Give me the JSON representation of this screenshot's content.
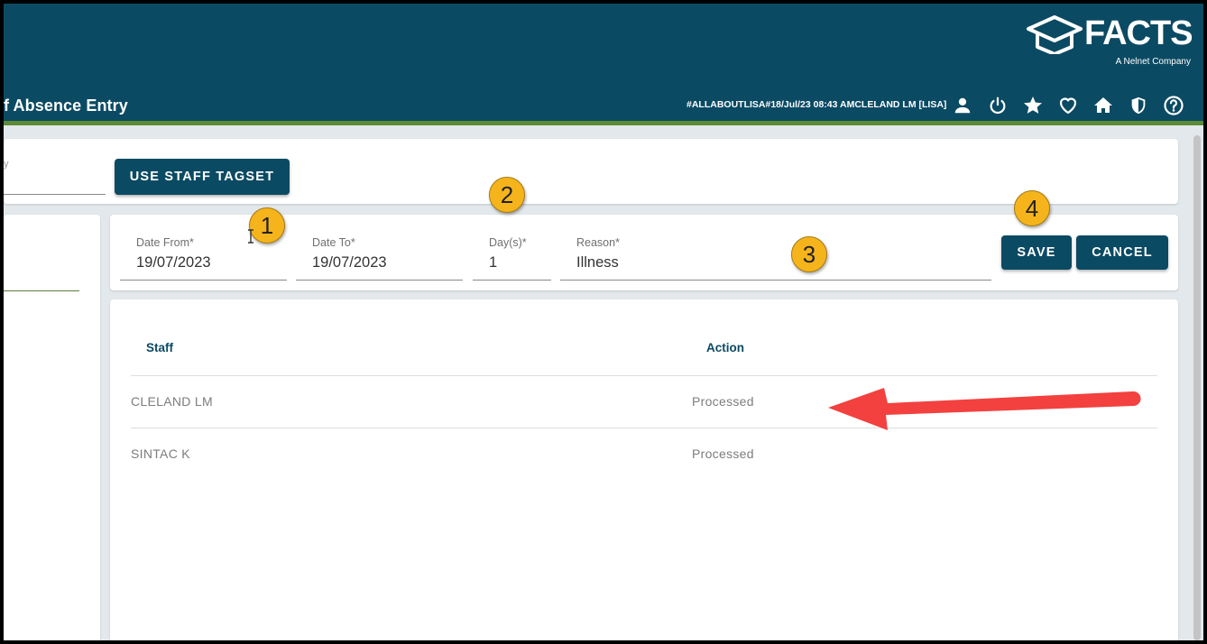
{
  "header": {
    "page_title": "f Absence Entry",
    "brand": "FACTS",
    "brand_tagline": "A Nelnet Company",
    "session_info": "#ALLABOUTLISA#18/Jul/23 08:43 AMCLELAND LM [LISA]",
    "icons": [
      "user-icon",
      "power-icon",
      "star-icon",
      "heart-icon",
      "home-icon",
      "shield-icon",
      "help-icon"
    ]
  },
  "toolbar": {
    "search_placeholder_fragment": "y",
    "tagset_button": "USE STAFF TAGSET"
  },
  "form": {
    "date_from": {
      "label": "Date From*",
      "value": "19/07/2023"
    },
    "date_to": {
      "label": "Date To*",
      "value": "19/07/2023"
    },
    "days": {
      "label": "Day(s)*",
      "value": "1"
    },
    "reason": {
      "label": "Reason*",
      "value": "Illness"
    },
    "save_label": "SAVE",
    "cancel_label": "CANCEL"
  },
  "table": {
    "columns": [
      "Staff",
      "Action"
    ],
    "rows": [
      {
        "staff": "CLELAND LM",
        "action": "Processed"
      },
      {
        "staff": "SINTAC K",
        "action": "Processed"
      }
    ]
  },
  "annotations": {
    "badges": [
      "1",
      "2",
      "3",
      "4"
    ],
    "badge_color": "#f6b41c",
    "arrow_color": "#f2413f"
  },
  "colors": {
    "brand": "#0b4a63",
    "accent_stripe": "#5d8a35",
    "background": "#e2e8eb"
  }
}
